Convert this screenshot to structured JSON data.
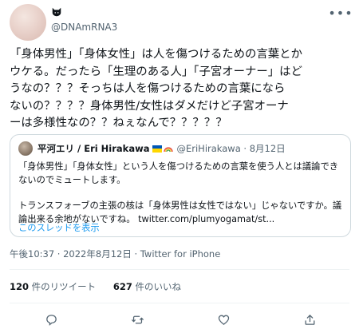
{
  "tweet": {
    "display_name": "",
    "display_icon": "cat-icon",
    "handle": "@DNAmRNA3",
    "text_lines": [
      "「身体男性」「身体女性」は人を傷つけるための言葉とか",
      "ウケる。だったら「生理のある人」「子宮オーナー」はど",
      "うなの？？？そっちは人を傷つけるための言葉になら",
      "ないの？？？？身体男性/女性はダメだけど子宮オーナ",
      "ーは多様性なの？？ねぇなんで？？？？？"
    ],
    "timestamp": "午後10:37 · 2022年8月12日 · Twitter for iPhone"
  },
  "quote": {
    "name": "平河エリ / Eri Hirakawa",
    "handle_date": "@EriHirakawa · 8月12日",
    "para1": [
      "「身体男性」「身体女性」という人を傷つけるための言葉を使う人とは議論でき",
      "ないのでミュートします。"
    ],
    "para2": [
      "トランスフォーブの主張の核は「身体男性は女性ではない」じゃないですか。議",
      "論出来る余地がないですね。 twitter.com/plumyogamat/st..."
    ],
    "thread_link": "このスレッドを表示"
  },
  "stats": {
    "retweets_count": "120",
    "retweets_label": " 件のリツイート",
    "likes_count": "627",
    "likes_label": " 件のいいね"
  },
  "colors": {
    "text": "#0f1419",
    "secondary": "#536471",
    "link": "#1d9bf0",
    "border": "#cfd9de"
  },
  "icons": [
    "cat-icon",
    "more-icon",
    "reply-icon",
    "retweet-icon",
    "like-icon",
    "share-icon"
  ]
}
